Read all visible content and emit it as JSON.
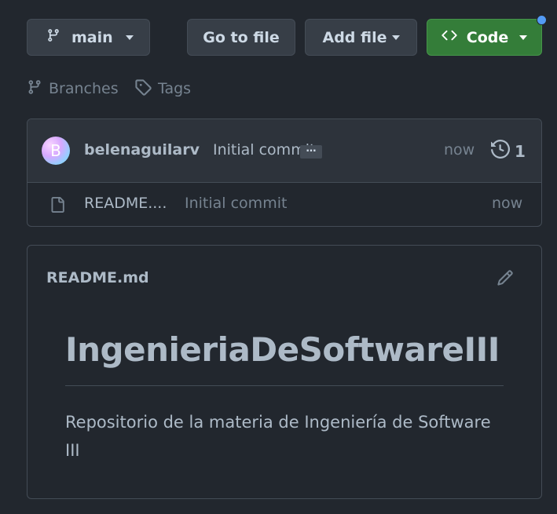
{
  "toolbar": {
    "branch_label": "main",
    "goto_label": "Go to file",
    "addfile_label": "Add file",
    "code_label": "Code"
  },
  "links": {
    "branches": "Branches",
    "tags": "Tags"
  },
  "commit": {
    "avatar_initial": "B",
    "author": "belenaguilarv",
    "message": "Initial commit",
    "ellipsis": "…",
    "time": "now",
    "count": "1"
  },
  "files": [
    {
      "name": "README....",
      "commit": "Initial commit",
      "time": "now"
    }
  ],
  "readme": {
    "filename": "README.md",
    "heading": "IngenieriaDeSoftwareIII",
    "body": "Repositorio de la materia de Ingeniería de Software III"
  },
  "colors": {
    "background": "#22272e",
    "code_button": "#347d39",
    "notification_dot": "#539bf5"
  }
}
